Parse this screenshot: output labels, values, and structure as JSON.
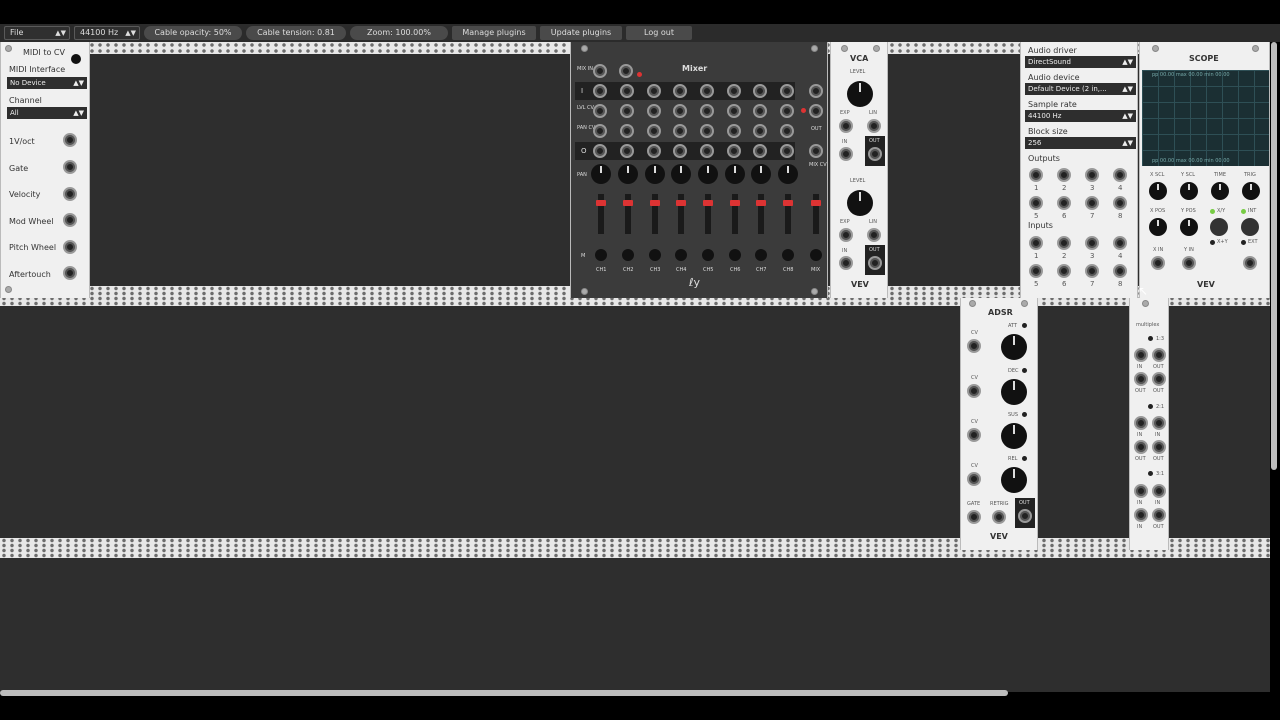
{
  "toolbar": {
    "file_menu": "File",
    "sample_rate": "44100 Hz",
    "cable_opacity": "Cable opacity: 50%",
    "cable_tension": "Cable tension: 0.81",
    "zoom": "Zoom: 100.00%",
    "manage_plugins": "Manage plugins",
    "update_plugins": "Update plugins",
    "log_out": "Log out"
  },
  "midi": {
    "title": "MIDI to CV",
    "interface_label": "MIDI Interface",
    "interface_value": "No Device",
    "channel_label": "Channel",
    "channel_value": "All",
    "outputs": [
      "1V/oct",
      "Gate",
      "Velocity",
      "Mod Wheel",
      "Pitch Wheel",
      "Aftertouch"
    ]
  },
  "mixer": {
    "title": "Mixer",
    "mix_in": "MIX IN",
    "row_labels": [
      "I",
      "LVL CV",
      "PAN CV",
      "O",
      "PAN",
      "M"
    ],
    "out_label": "OUT",
    "mix_cv_label": "MIX CV",
    "channels": [
      "CH1",
      "CH2",
      "CH3",
      "CH4",
      "CH5",
      "CH6",
      "CH7",
      "CH8",
      "MIX"
    ]
  },
  "vca": {
    "title": "VCA",
    "level": "LEVEL",
    "exp": "EXP",
    "lin": "LIN",
    "in": "IN",
    "out": "OUT",
    "brand": "VEV"
  },
  "audio": {
    "driver_label": "Audio driver",
    "driver_value": "DirectSound",
    "device_label": "Audio device",
    "device_value": "Default Device (2 in,...",
    "rate_label": "Sample rate",
    "rate_value": "44100 Hz",
    "block_label": "Block size",
    "block_value": "256",
    "outputs_label": "Outputs",
    "inputs_label": "Inputs",
    "out_nums": [
      "1",
      "2",
      "3",
      "4",
      "5",
      "6",
      "7",
      "8"
    ],
    "in_nums": [
      "1",
      "2",
      "3",
      "4",
      "5",
      "6",
      "7",
      "8"
    ]
  },
  "scope": {
    "title": "SCOPE",
    "readout_top": "pp  00.00  max  00.00  min  00.00",
    "readout_bottom": "pp  00.00  max  00.00  min  00.00",
    "xscl": "X SCL",
    "yscl": "Y SCL",
    "time": "TIME",
    "trig": "TRIG",
    "xpos": "X POS",
    "ypos": "Y POS",
    "xy": "X/Y",
    "int": "INT",
    "xy_mode": "X+Y",
    "ext": "EXT",
    "xin": "X IN",
    "yin": "Y IN",
    "brand": "VEV"
  },
  "adsr": {
    "title": "ADSR",
    "att": "ATT",
    "dec": "DEC",
    "sus": "SUS",
    "rel": "REL",
    "cv": "CV",
    "gate": "GATE",
    "retrig": "RETRIG",
    "out": "OUT",
    "brand": "VEV"
  },
  "mult": {
    "title": "multiplex",
    "ratio1": "1:3",
    "ratio2": "2:1",
    "ratio3": "3:1",
    "in": "IN",
    "out": "OUT"
  }
}
